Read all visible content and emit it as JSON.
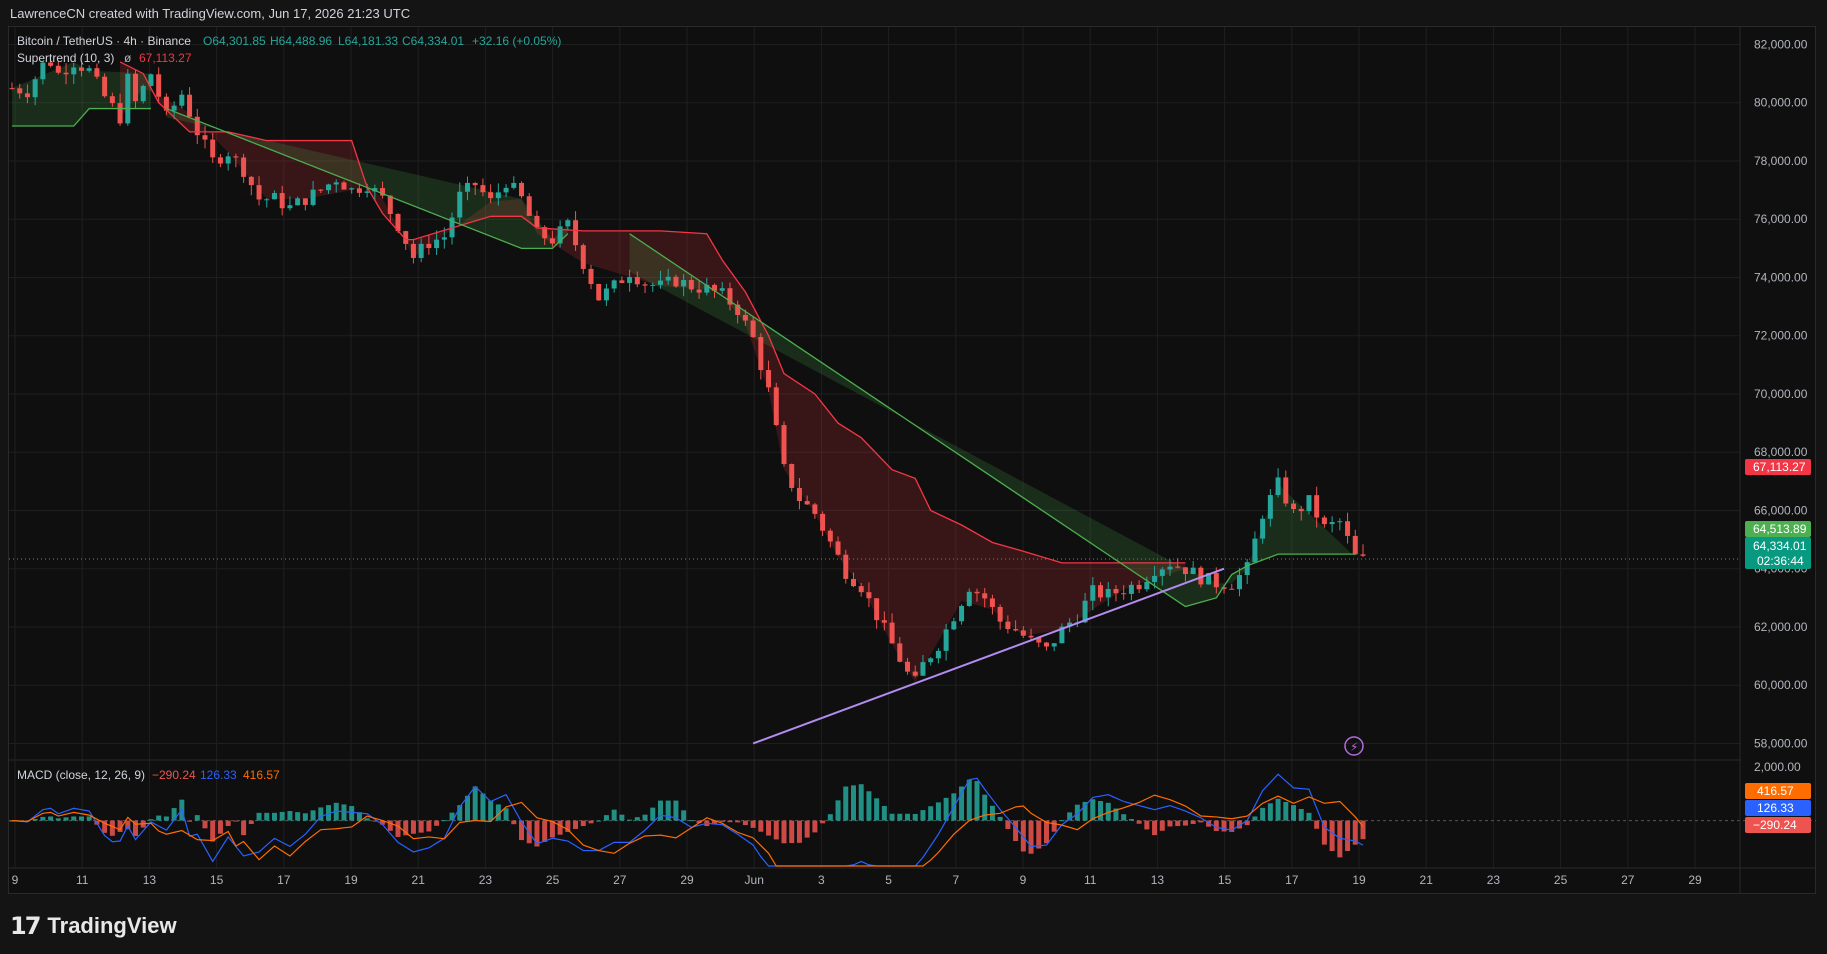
{
  "header": {
    "attribution": "LawrenceCN created with TradingView.com, Jun 17, 2026 21:23 UTC"
  },
  "legend": {
    "symbol": "Bitcoin / TetherUS · 4h · Binance",
    "open": "O64,301.85",
    "high": "H64,488.96",
    "low": "L64,181.33",
    "close": "C64,334.01",
    "change": "+32.16 (+0.05%)",
    "supertrend_label": "Supertrend (10, 3)",
    "supertrend_value": "67,113.27",
    "macd_label": "MACD (close, 12, 26, 9)",
    "macd_hist": "−290.24",
    "macd_line": "126.33",
    "macd_signal": "416.57"
  },
  "price_axis": {
    "ticks": [
      "82,000.00",
      "80,000.00",
      "78,000.00",
      "76,000.00",
      "74,000.00",
      "72,000.00",
      "70,000.00",
      "68,000.00",
      "66,000.00",
      "64,000.00",
      "62,000.00",
      "60,000.00",
      "58,000.00"
    ],
    "tick_values": [
      82000,
      80000,
      78000,
      76000,
      74000,
      72000,
      70000,
      68000,
      66000,
      64000,
      62000,
      60000,
      58000
    ],
    "badges": {
      "supertrend": "67,113.27",
      "bid": "64,513.89",
      "last": "64,334.01",
      "countdown": "02:36:44"
    }
  },
  "macd_axis": {
    "top_tick": "2,000.00",
    "badges": {
      "signal": "416.57",
      "macd": "126.33",
      "hist": "−290.24"
    }
  },
  "time_axis": {
    "labels": [
      "9",
      "11",
      "13",
      "15",
      "17",
      "19",
      "21",
      "23",
      "25",
      "27",
      "29",
      "Jun",
      "3",
      "5",
      "7",
      "9",
      "11",
      "13",
      "15",
      "17",
      "19",
      "21",
      "23",
      "25",
      "27",
      "29"
    ]
  },
  "brand": {
    "name": "TradingView",
    "mark": "17"
  },
  "colors": {
    "up": "#26a69a",
    "down": "#ef5350",
    "supertrend_down": "#f23645",
    "supertrend_up": "#4caf50",
    "trendline": "#b38cf0",
    "macd_line": "#2962ff",
    "signal_line": "#ff6d00"
  },
  "chart_data": {
    "type": "candlestick",
    "interval": "4h",
    "ylim": [
      57500,
      82600
    ],
    "macd_ylim": [
      -1500,
      2000
    ],
    "price_path": [
      [
        0,
        80500
      ],
      [
        2,
        80400
      ],
      [
        4,
        81300
      ],
      [
        5,
        81400
      ],
      [
        6,
        81000
      ],
      [
        8,
        81400
      ],
      [
        10,
        81100
      ],
      [
        12,
        80200
      ],
      [
        14,
        79500
      ],
      [
        15,
        80800
      ],
      [
        16,
        80000
      ],
      [
        18,
        81000
      ],
      [
        20,
        79500
      ],
      [
        22,
        80300
      ],
      [
        24,
        79000
      ],
      [
        26,
        78000
      ],
      [
        28,
        78300
      ],
      [
        30,
        77700
      ],
      [
        32,
        76700
      ],
      [
        34,
        76700
      ],
      [
        36,
        76400
      ],
      [
        38,
        76700
      ],
      [
        40,
        77000
      ],
      [
        42,
        77400
      ],
      [
        44,
        77000
      ],
      [
        46,
        77200
      ],
      [
        48,
        76700
      ],
      [
        50,
        75800
      ],
      [
        52,
        74700
      ],
      [
        54,
        75200
      ],
      [
        56,
        75400
      ],
      [
        58,
        76800
      ],
      [
        60,
        77200
      ],
      [
        62,
        76600
      ],
      [
        64,
        77300
      ],
      [
        66,
        76700
      ],
      [
        68,
        75500
      ],
      [
        70,
        75300
      ],
      [
        72,
        75800
      ],
      [
        74,
        74500
      ],
      [
        76,
        73300
      ],
      [
        78,
        73700
      ],
      [
        80,
        74200
      ],
      [
        82,
        73800
      ],
      [
        84,
        73700
      ],
      [
        86,
        73900
      ],
      [
        88,
        73700
      ],
      [
        90,
        73600
      ],
      [
        92,
        73400
      ],
      [
        94,
        72900
      ],
      [
        96,
        71900
      ],
      [
        98,
        70100
      ],
      [
        100,
        67400
      ],
      [
        102,
        66400
      ],
      [
        104,
        65900
      ],
      [
        106,
        64900
      ],
      [
        108,
        63900
      ],
      [
        110,
        63400
      ],
      [
        112,
        62400
      ],
      [
        114,
        61400
      ],
      [
        116,
        60400
      ],
      [
        117,
        60100
      ],
      [
        118,
        60700
      ],
      [
        120,
        61400
      ],
      [
        122,
        62400
      ],
      [
        124,
        63400
      ],
      [
        126,
        63000
      ],
      [
        128,
        62200
      ],
      [
        130,
        61900
      ],
      [
        132,
        61500
      ],
      [
        134,
        61200
      ],
      [
        136,
        61900
      ],
      [
        138,
        62400
      ],
      [
        140,
        63200
      ],
      [
        142,
        63100
      ],
      [
        144,
        63300
      ],
      [
        146,
        63500
      ],
      [
        148,
        64000
      ],
      [
        150,
        64200
      ],
      [
        152,
        64000
      ],
      [
        154,
        63700
      ],
      [
        156,
        63500
      ],
      [
        158,
        63500
      ],
      [
        160,
        64000
      ],
      [
        162,
        65900
      ],
      [
        164,
        66900
      ],
      [
        166,
        65900
      ],
      [
        168,
        66300
      ],
      [
        170,
        65400
      ],
      [
        172,
        65600
      ],
      [
        174,
        64400
      ],
      [
        175,
        64300
      ]
    ],
    "supertrend_down": [
      [
        14,
        81400
      ],
      [
        17,
        81000
      ],
      [
        19,
        80000
      ],
      [
        23,
        79000
      ],
      [
        28,
        79000
      ],
      [
        33,
        78700
      ],
      [
        38,
        78700
      ],
      [
        44,
        78700
      ],
      [
        46,
        77100
      ],
      [
        48,
        76200
      ],
      [
        51,
        75300
      ],
      [
        52,
        75300
      ],
      [
        62,
        76100
      ],
      [
        66,
        76100
      ],
      [
        68,
        75700
      ],
      [
        74,
        75600
      ],
      [
        84,
        75600
      ],
      [
        90,
        75500
      ],
      [
        92,
        74600
      ],
      [
        95,
        73500
      ],
      [
        98,
        72000
      ],
      [
        100,
        70700
      ],
      [
        104,
        70000
      ],
      [
        107,
        69000
      ],
      [
        110,
        68500
      ],
      [
        114,
        67400
      ],
      [
        117,
        67100
      ],
      [
        119,
        66000
      ],
      [
        123,
        65500
      ],
      [
        127,
        64900
      ],
      [
        131,
        64600
      ],
      [
        136,
        64200
      ],
      [
        144,
        64200
      ],
      [
        152,
        64200
      ]
    ],
    "supertrend_up": [
      [
        0,
        79200
      ],
      [
        8,
        79200
      ],
      [
        10,
        79800
      ],
      [
        18,
        79800
      ],
      [
        20,
        79800
      ],
      [
        66,
        75000
      ],
      [
        70,
        75000
      ],
      [
        72,
        75500
      ],
      [
        80,
        75500
      ],
      [
        152,
        62700
      ],
      [
        156,
        63000
      ],
      [
        158,
        63800
      ],
      [
        160,
        64100
      ],
      [
        164,
        64500
      ],
      [
        174,
        64500
      ]
    ],
    "trendline": [
      [
        2026,
        58000
      ],
      [
        2027,
        64000
      ]
    ],
    "macd": {
      "hist_last": -290.24,
      "macd_last": 126.33,
      "signal_last": 416.57
    }
  }
}
